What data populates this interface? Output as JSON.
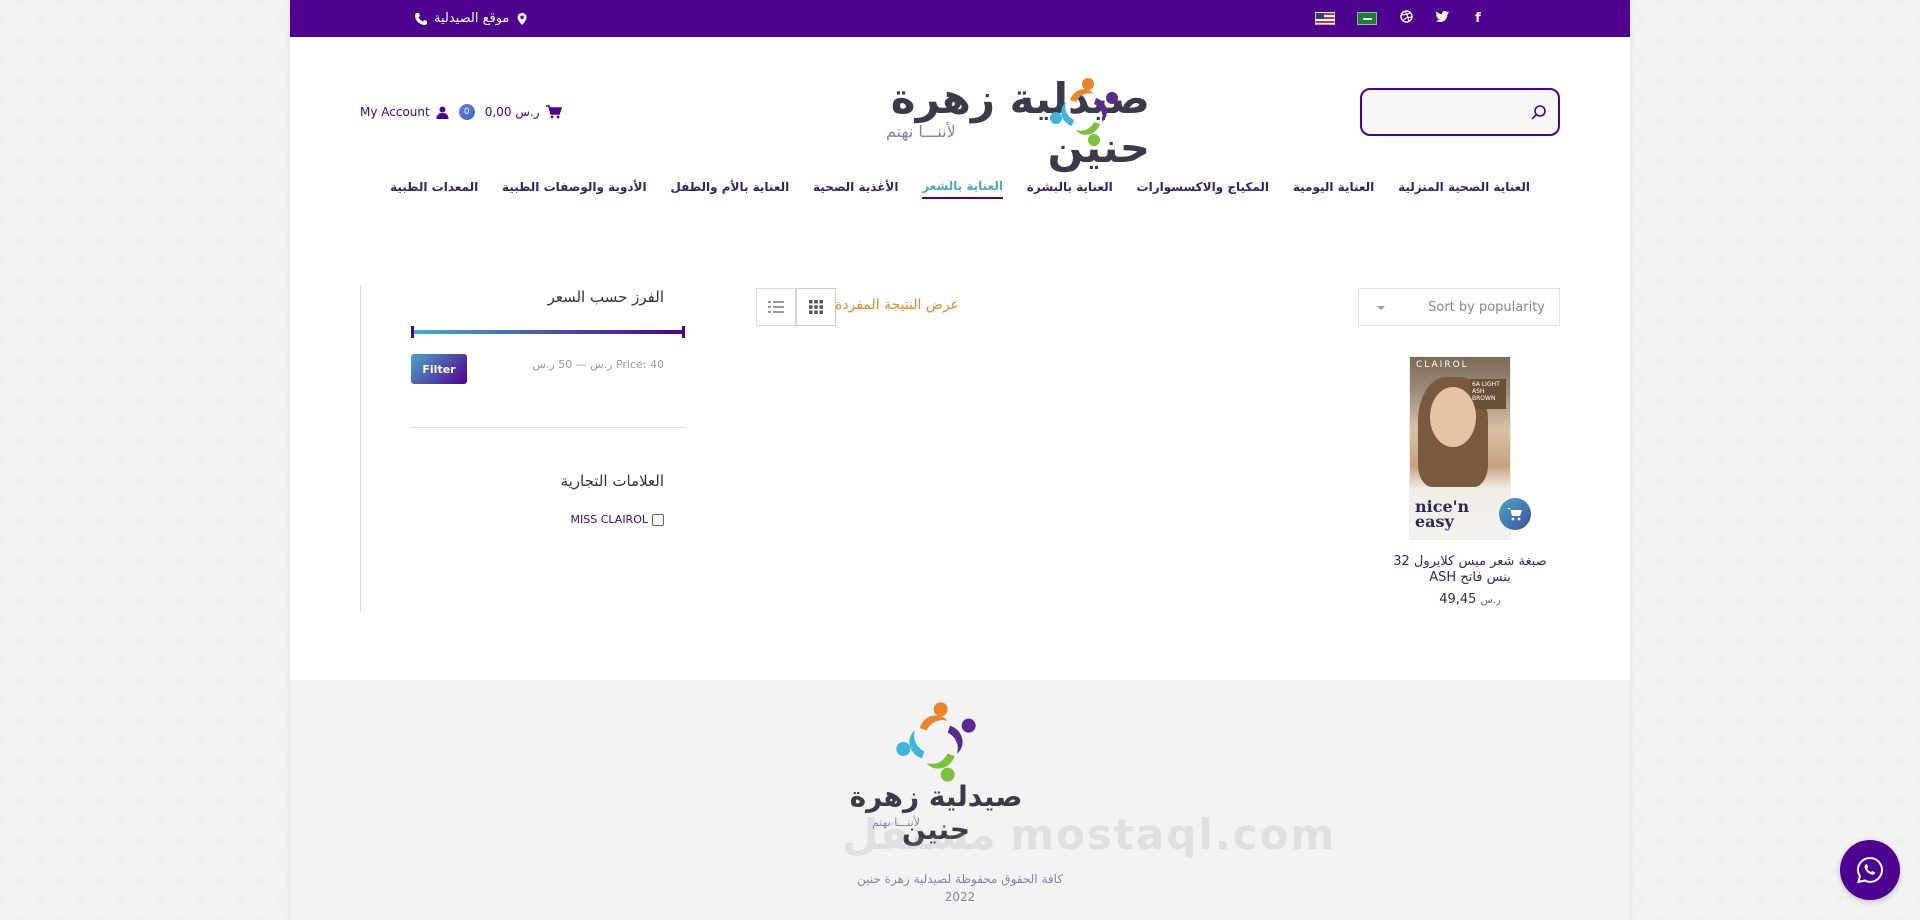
{
  "topbar": {
    "location_label": "موقع الصيدلية",
    "social": [
      "facebook-icon",
      "twitter-icon",
      "dribbble-icon"
    ],
    "flags": [
      "sa-flag",
      "us-flag"
    ]
  },
  "header": {
    "brand_name": "صيدلية زهرة حنين",
    "tagline": "لأننـــا نهتم",
    "search_placeholder": "",
    "cart_amount": "0,00 ر.س",
    "cart_count": "0",
    "account_label": "My Account"
  },
  "nav": [
    "المعدات الطبية",
    "الأدوية والوصفات الطبية",
    "العناية بالأم والطفل",
    "الأغذية الصحية",
    "العناية بالشعر",
    "العناية بالبشرة",
    "المكياج والاكسسوارات",
    "العناية اليومية",
    "العناية الصحية المنزلية"
  ],
  "nav_active_index": 4,
  "sidebar": {
    "price_filter_title": "الفرز حسب السعر",
    "filter_button": "Filter",
    "price_range_text": "Price: 40 ر.س — 50 ر.س",
    "brands_title": "العلامات التجارية",
    "brands": [
      "MISS CLAIROL"
    ]
  },
  "toolbar": {
    "result_count": "عرض النتيجة المفردة",
    "sort_selected": "Sort by popularity"
  },
  "products": [
    {
      "name_line1": "صبغة شعر ميس كلايرول 32",
      "name_line2": "بنس فاتح ASH",
      "price": "49,45",
      "currency": "ر.س",
      "image_brand": "CLAIROL",
      "image_shade": "6A LIGHT ASH BROWN",
      "image_product": "nice'n easy"
    }
  ],
  "footer": {
    "brand_name": "صيدلية زهرة حنين",
    "tagline": "لأننـــا نهتم",
    "copyright_line1": "كافة الحقوق محفوظة لصيدلية زهرة حنين",
    "copyright_line2": "2022",
    "watermark": "مستقل mostaql.com"
  },
  "colors": {
    "primary": "#4e008e",
    "accent": "#4da6c7",
    "orange": "#e08a2e"
  }
}
